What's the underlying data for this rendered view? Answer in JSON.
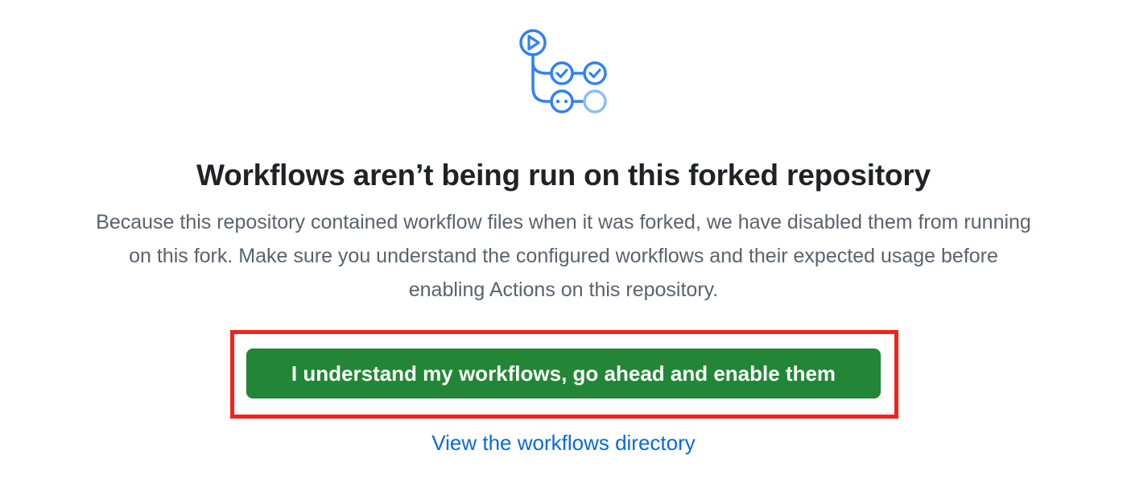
{
  "blankslate": {
    "icon": "workflow-icon",
    "title": "Workflows aren’t being run on this forked repository",
    "description_lines": [
      "Because this repository contained workflow files when it was forked, we have disabled them from running",
      "on this fork. Make sure you understand the configured workflows and their expected usage before",
      "enabling Actions on this repository."
    ],
    "enable_button_label": "I understand my workflows, go ahead and enable them",
    "workflows_link_label": "View the workflows directory"
  },
  "colors": {
    "title": "#1f2328",
    "description": "#59636e",
    "button_background": "#238636",
    "button_text": "#ffffff",
    "link": "#0969da",
    "icon_primary": "#2f81f7",
    "icon_secondary": "#8ebdf8",
    "highlight_frame": "#f5221b"
  }
}
